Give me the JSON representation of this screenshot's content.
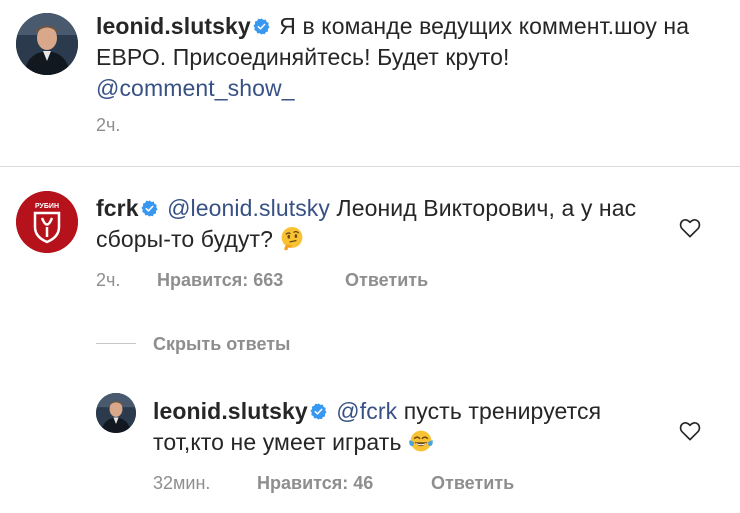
{
  "post": {
    "username": "leonid.slutsky",
    "caption": "Я в команде ведущих коммент.шоу на ЕВРО. Присоединяйтесь! Будет круто!",
    "mention": "@comment_show_",
    "time": "2ч."
  },
  "comments": [
    {
      "username": "fcrk",
      "mention": "@leonid.slutsky",
      "text": "Леонид Викторович, а у нас сборы-то будут?",
      "emoji": "thinking-face",
      "time": "2ч.",
      "likes": "Нравится: 663",
      "reply_label": "Ответить",
      "avatar_text": "РУБИН"
    },
    {
      "username": "leonid.slutsky",
      "mention": "@fcrk",
      "text": "пусть тренируется тот,кто не умеет играть",
      "emoji": "tears-of-joy-face",
      "time": "32мин.",
      "likes": "Нравится: 46",
      "reply_label": "Ответить"
    }
  ],
  "hide_replies_label": "Скрыть ответы",
  "colors": {
    "text": "#262626",
    "secondary": "#8e8e8e",
    "mention": "#385185",
    "verified": "#3897f0",
    "fcrk_red": "#b5121b",
    "divider": "#dbdbdb"
  }
}
